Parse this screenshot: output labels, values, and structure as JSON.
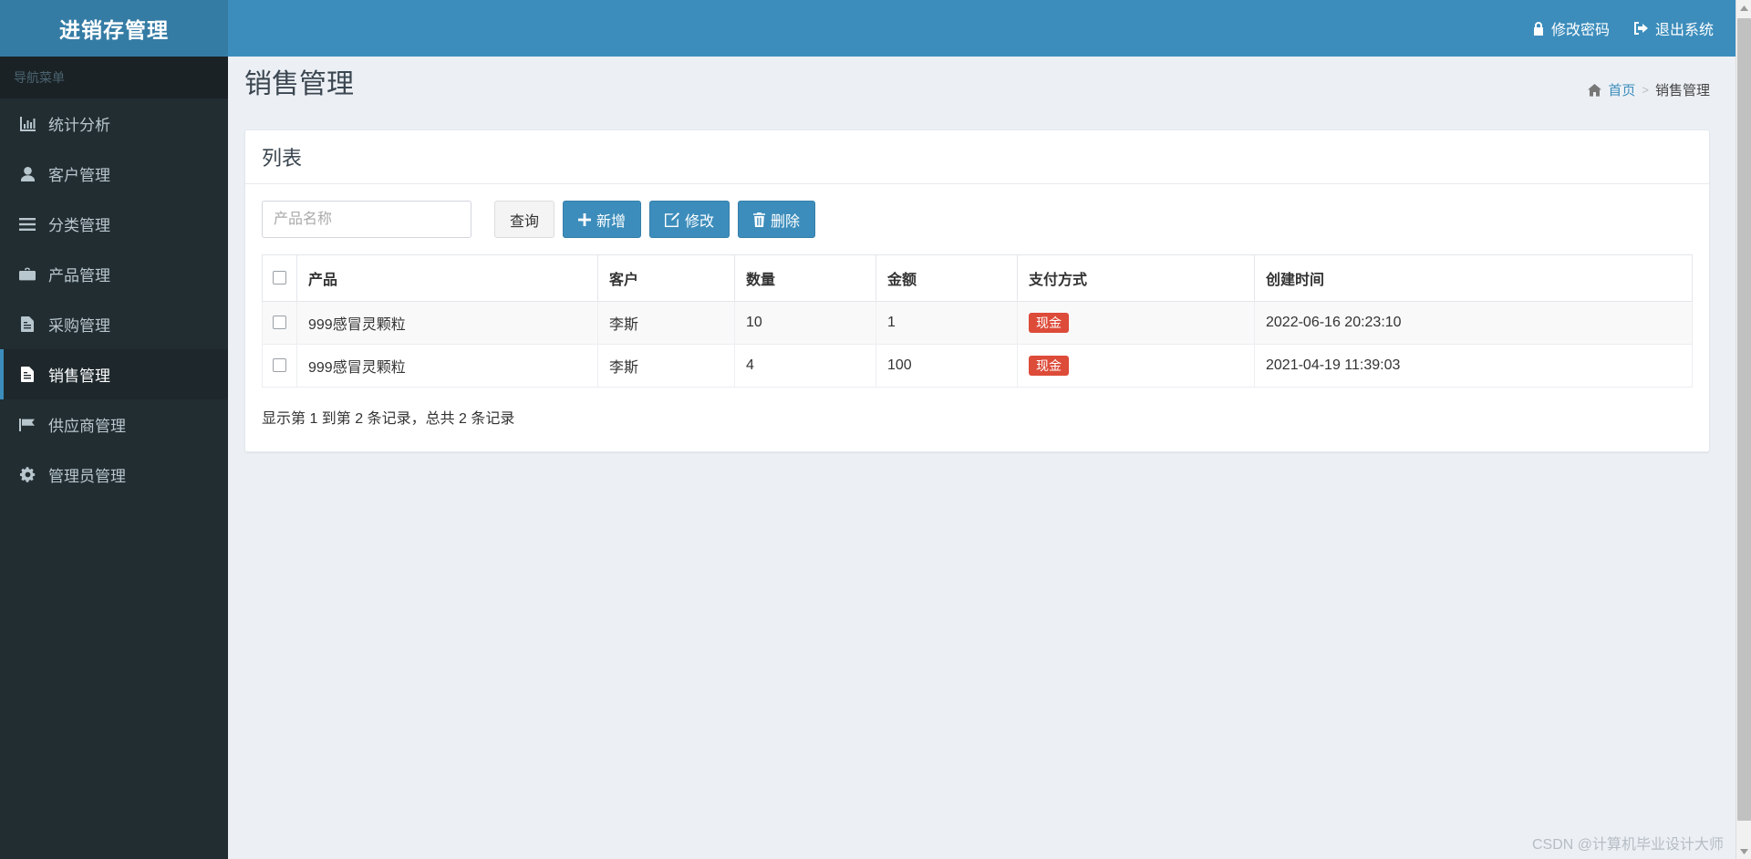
{
  "app": {
    "logo_title": "进销存管理"
  },
  "topbar": {
    "links": [
      {
        "label": "修改密码",
        "icon": "lock-icon"
      },
      {
        "label": "退出系统",
        "icon": "sign-out-icon"
      }
    ]
  },
  "sidebar": {
    "header": "导航菜单",
    "items": [
      {
        "label": "统计分析",
        "icon": "bar-chart-icon",
        "active": false
      },
      {
        "label": "客户管理",
        "icon": "user-icon",
        "active": false
      },
      {
        "label": "分类管理",
        "icon": "bars-icon",
        "active": false
      },
      {
        "label": "产品管理",
        "icon": "briefcase-icon",
        "active": false
      },
      {
        "label": "采购管理",
        "icon": "file-text-icon",
        "active": false
      },
      {
        "label": "销售管理",
        "icon": "file-text-icon",
        "active": true
      },
      {
        "label": "供应商管理",
        "icon": "flag-icon",
        "active": false
      },
      {
        "label": "管理员管理",
        "icon": "gear-icon",
        "active": false
      }
    ]
  },
  "page": {
    "title": "销售管理",
    "breadcrumb": {
      "home_icon": "home-icon",
      "home_label": "首页",
      "separator": ">",
      "current": "销售管理"
    }
  },
  "panel": {
    "heading": "列表"
  },
  "search": {
    "value": "",
    "placeholder": "产品名称"
  },
  "toolbar": {
    "query_label": "查询",
    "add_label": "新增",
    "edit_label": "修改",
    "delete_label": "删除"
  },
  "table": {
    "columns": [
      "产品",
      "客户",
      "数量",
      "金额",
      "支付方式",
      "创建时间"
    ],
    "rows": [
      {
        "product": "999感冒灵颗粒",
        "customer": "李斯",
        "quantity": "10",
        "amount": "1",
        "payment": "现金",
        "created_at": "2022-06-16 20:23:10"
      },
      {
        "product": "999感冒灵颗粒",
        "customer": "李斯",
        "quantity": "4",
        "amount": "100",
        "payment": "现金",
        "created_at": "2021-04-19 11:39:03"
      }
    ],
    "footer": "显示第 1 到第 2 条记录，总共 2 条记录"
  },
  "watermark": "CSDN @计算机毕业设计大师",
  "colors": {
    "brand": "#3c8dbc",
    "brand_dark": "#357ca5",
    "sidebar": "#222d32",
    "sidebar_dark": "#1a2226",
    "content_bg": "#ecf0f5",
    "danger": "#dd4b39"
  }
}
